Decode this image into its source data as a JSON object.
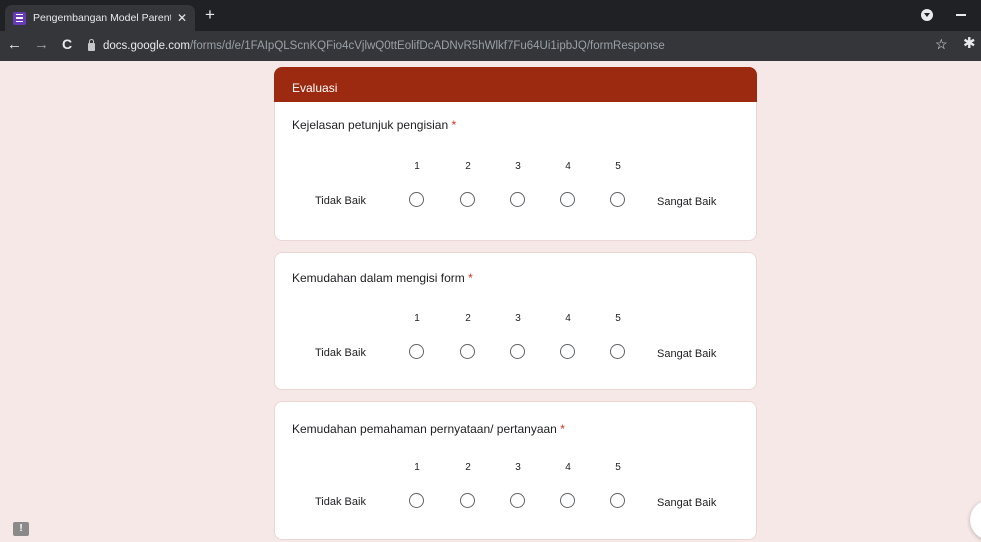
{
  "browser": {
    "tab_title": "Pengembangan Model Parenting",
    "tab_close": "✕",
    "new_tab": "+",
    "url_host": "docs.google.com",
    "url_path": "/forms/d/e/1FAIpQLScnKQFio4cVjlwQ0ttEolifDcADNvR5hWlkf7Fu64Ui1ipbJQ/formResponse",
    "back_icon": "←",
    "forward_icon": "→",
    "reload_icon": "C",
    "star_icon": "☆",
    "extension_icon": "✱"
  },
  "form": {
    "section_title": "Evaluasi",
    "required_mark": "*",
    "scale_labels": [
      "1",
      "2",
      "3",
      "4",
      "5"
    ],
    "low_label": "Tidak Baik",
    "high_label": "Sangat Baik",
    "questions": [
      "Kejelasan petunjuk pengisian",
      "Kemudahan dalam mengisi form",
      "Kemudahan pemahaman pernyataan/ pertanyaan"
    ]
  },
  "feedback_icon": "!"
}
